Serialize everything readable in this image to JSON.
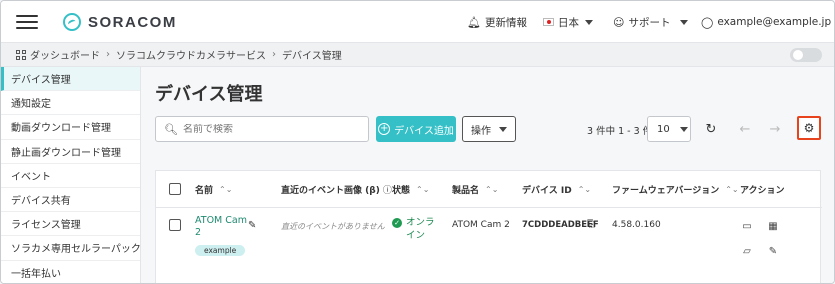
{
  "header": {
    "brand": "SORACOM",
    "news": "更新情報",
    "language": "日本",
    "support": "サポート",
    "account": "example@example.jp"
  },
  "breadcrumb": {
    "items": [
      "ダッシュボード",
      "ソラコムクラウドカメラサービス",
      "デバイス管理"
    ]
  },
  "sidebar": {
    "items": [
      {
        "label": "デバイス管理",
        "active": true
      },
      {
        "label": "通知設定"
      },
      {
        "label": "動画ダウンロード管理"
      },
      {
        "label": "静止画ダウンロード管理"
      },
      {
        "label": "イベント"
      },
      {
        "label": "デバイス共有"
      },
      {
        "label": "ライセンス管理"
      },
      {
        "label": "ソラカメ専用セルラーパック"
      },
      {
        "label": "一括年払い"
      }
    ]
  },
  "main": {
    "title": "デバイス管理",
    "search_placeholder": "名前で検索",
    "add_button": "デバイス追加",
    "operations_button": "操作",
    "pager_text": "3 件中 1 - 3 件",
    "per_page": "10"
  },
  "table": {
    "columns": {
      "name": "名前",
      "recent_image": "直近のイベント画像 (β)",
      "status": "状態",
      "product": "製品名",
      "device_id": "デバイス ID",
      "firmware": "ファームウェアバージョン",
      "actions": "アクション"
    },
    "rows": [
      {
        "name_line1": "ATOM Cam",
        "name_line2": "2",
        "tag": "example",
        "recent_image": "直近のイベントがありません",
        "status_line1": "オンラ",
        "status_line2": "イン",
        "product": "ATOM Cam 2",
        "device_id": "7CDDDEADBEEF",
        "firmware": "4.58.0.160"
      }
    ]
  },
  "colors": {
    "accent": "#34c0c6",
    "online": "#1f9a52",
    "highlight": "#e8431c"
  }
}
